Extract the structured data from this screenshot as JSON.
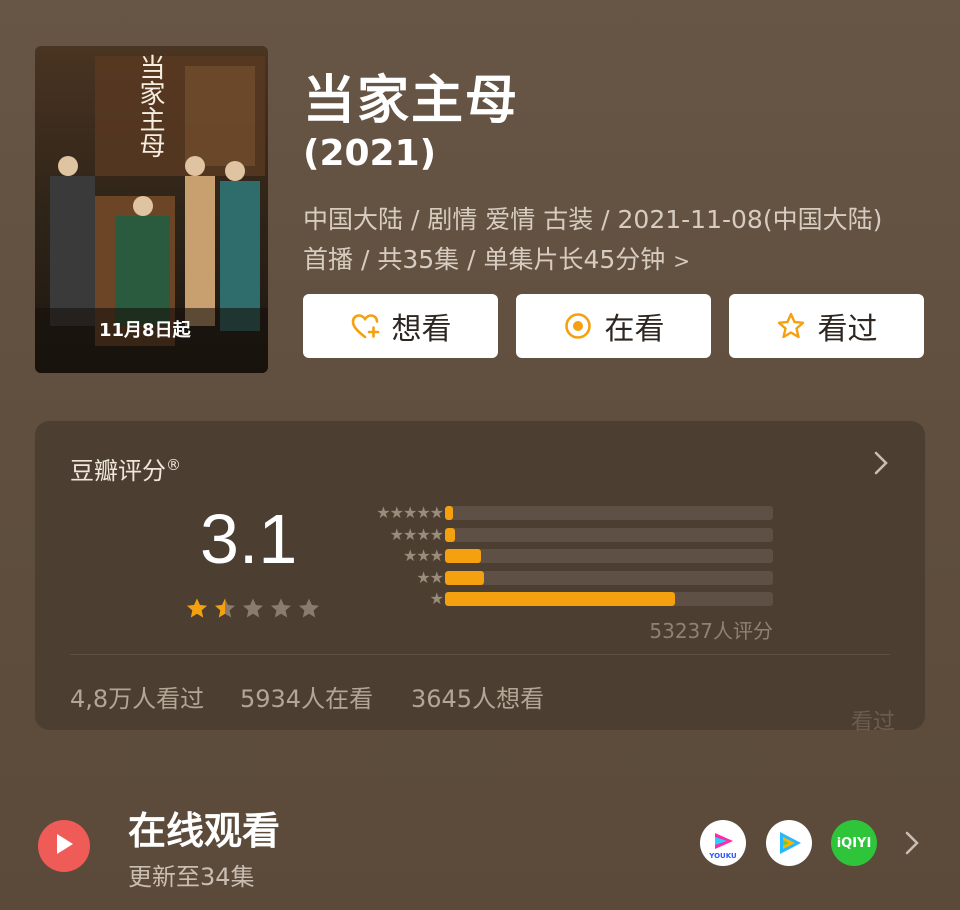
{
  "movie": {
    "title": "当家主母",
    "year": "(2021)",
    "meta_line1": "中国大陆 / 剧情 爱情 古装 / 2021-11-08(中国大陆)",
    "meta_line2": "首播 / 共35集 / 单集片长45分钟",
    "poster": {
      "title_art": "当家主母",
      "date_text": "11月8日起"
    }
  },
  "actions": {
    "want_label": "想看",
    "watching_label": "在看",
    "watched_label": "看过"
  },
  "rating": {
    "heading": "豆瓣评分",
    "registered_mark": "®",
    "score": "3.1",
    "star_level": 1.5,
    "star_max": 5,
    "distribution": [
      {
        "stars": "★★★★★",
        "fraction": 0.02
      },
      {
        "stars": "★★★★",
        "fraction": 0.03
      },
      {
        "stars": "★★★",
        "fraction": 0.11
      },
      {
        "stars": "★★",
        "fraction": 0.12
      },
      {
        "stars": "★",
        "fraction": 0.7
      }
    ],
    "votes": "53237人评分",
    "stats": {
      "watched": "4,8万人看过",
      "watching": "5934人在看",
      "want": "3645人想看"
    },
    "watermark": "看过"
  },
  "online": {
    "title": "在线观看",
    "subtitle": "更新至34集",
    "platforms": [
      {
        "name": "youku",
        "label": "YOUKU"
      },
      {
        "name": "tencent-video",
        "label": ""
      },
      {
        "name": "iqiyi",
        "label": "iQIYI"
      }
    ]
  },
  "colors": {
    "background": "#645341",
    "card": "#4c3e31",
    "accent": "#f5a00f",
    "play": "#ef5b56",
    "iqiyi": "#2fc53a"
  }
}
